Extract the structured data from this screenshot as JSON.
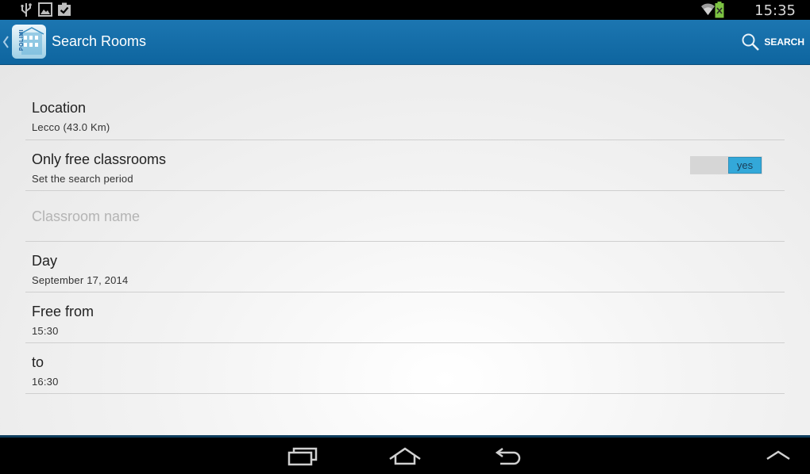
{
  "status_bar": {
    "time": "15:35",
    "icons": [
      "usb-icon",
      "image-icon",
      "clipboard-check-icon",
      "wifi-icon",
      "battery-charging-icon"
    ]
  },
  "action_bar": {
    "title": "Search Rooms",
    "app_icon_text": "POLIMI",
    "search_label": "SEARCH",
    "accent": "#1a72ad"
  },
  "form": {
    "location": {
      "title": "Location",
      "value": "Lecco (43.0 Km)"
    },
    "free_classrooms": {
      "title": "Only free classrooms",
      "subtitle": "Set the search period",
      "toggle_label": "yes",
      "toggle_color": "#33a8d9"
    },
    "classroom_name": {
      "placeholder": "Classroom name",
      "value": ""
    },
    "day": {
      "title": "Day",
      "value": "September 17, 2014"
    },
    "free_from": {
      "title": "Free from",
      "value": "15:30"
    },
    "to": {
      "title": "to",
      "value": "16:30"
    }
  },
  "nav_bar": {
    "icons": [
      "recent-apps-icon",
      "home-icon",
      "back-icon",
      "chevron-up-icon"
    ]
  }
}
